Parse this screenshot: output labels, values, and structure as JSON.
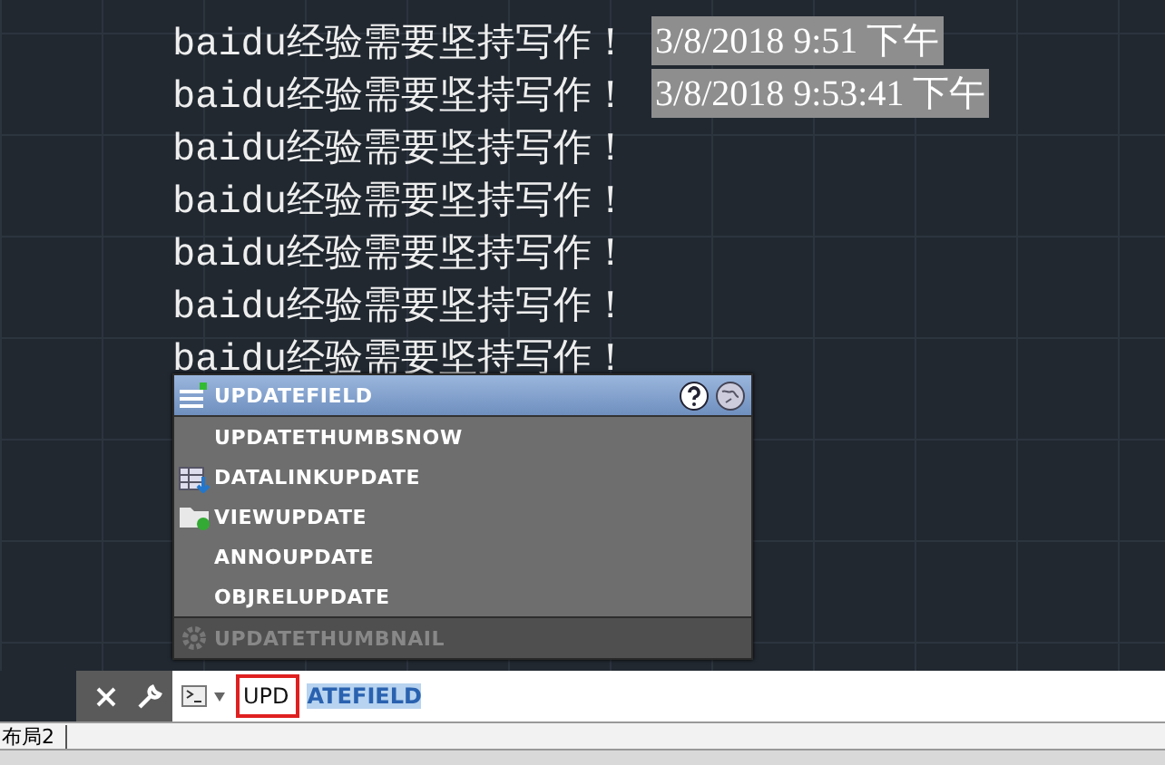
{
  "drawing_lines": [
    {
      "text": "baidu经验需要坚持写作！",
      "stamp": {
        "text": "3/8/2018 9:51 下午",
        "selected": true
      }
    },
    {
      "text": "baidu经验需要坚持写作！",
      "stamp": {
        "text": "3/8/2018 9:53:41 下午",
        "selected": true
      }
    },
    {
      "text": "baidu经验需要坚持写作！"
    },
    {
      "text": "baidu经验需要坚持写作！"
    },
    {
      "text": "baidu经验需要坚持写作！"
    },
    {
      "text": "baidu经验需要坚持写作！"
    },
    {
      "text": "baidu经验需要坚持写作！"
    }
  ],
  "autocomplete": {
    "items": [
      {
        "label": "UPDATEFIELD",
        "kind": "field",
        "selected": true,
        "disabled": false
      },
      {
        "label": "UPDATETHUMBSNOW",
        "kind": "plain",
        "selected": false,
        "disabled": false
      },
      {
        "label": "DATALINKUPDATE",
        "kind": "datalink",
        "selected": false,
        "disabled": false
      },
      {
        "label": "VIEWUPDATE",
        "kind": "folder",
        "selected": false,
        "disabled": false
      },
      {
        "label": "ANNOUPDATE",
        "kind": "plain",
        "selected": false,
        "disabled": false
      },
      {
        "label": "OBJRELUPDATE",
        "kind": "plain",
        "selected": false,
        "disabled": false
      },
      {
        "label": "UPDATETHUMBNAIL",
        "kind": "gear",
        "selected": false,
        "disabled": true
      }
    ]
  },
  "command_line": {
    "typed": "UPD",
    "completion": "ATEFIELD"
  },
  "layout_tabs": [
    {
      "label": "布局2"
    }
  ]
}
